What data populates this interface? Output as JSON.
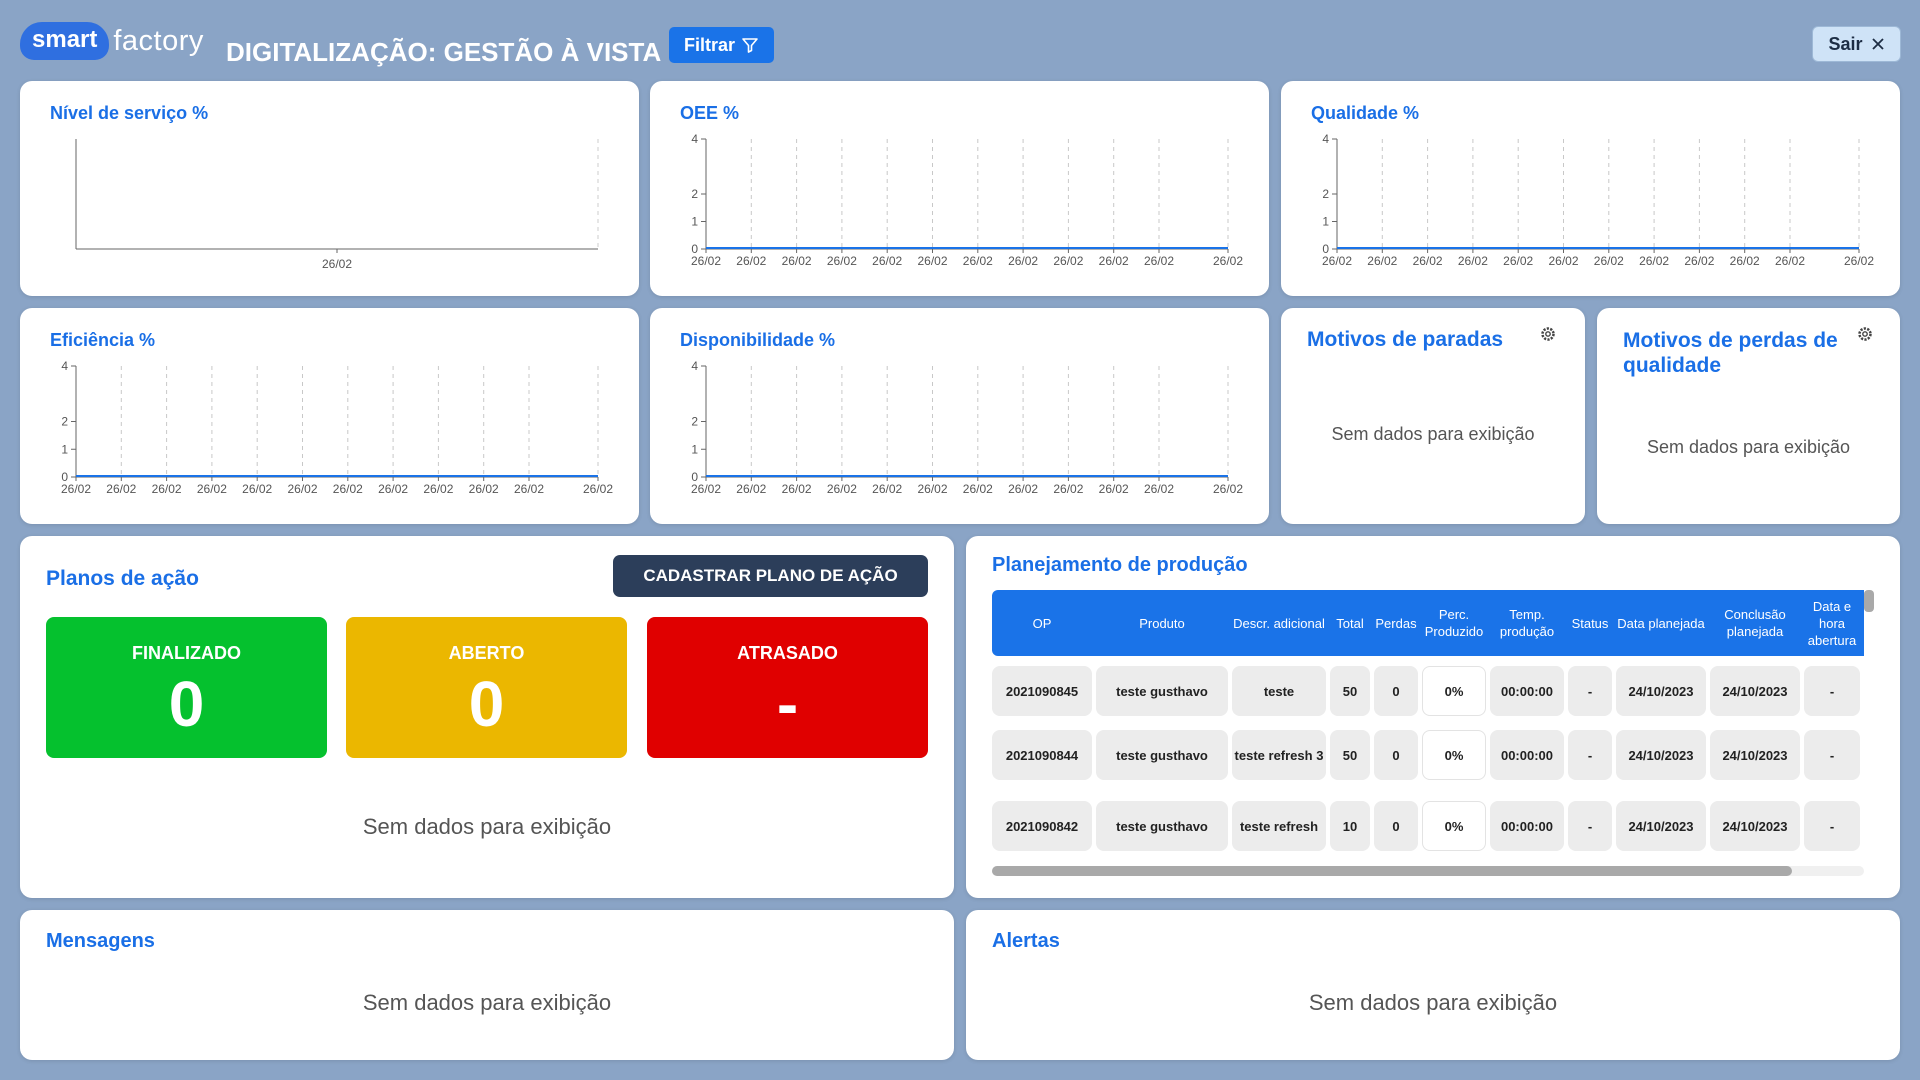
{
  "header": {
    "logo_word1": "smart",
    "logo_word2": "factory",
    "title": "DIGITALIZAÇÃO: GESTÃO À VISTA",
    "filter_label": "Filtrar",
    "exit_label": "Sair"
  },
  "charts": {
    "nivel_servico": {
      "title": "Nível de serviço %",
      "x_label": "26/02"
    },
    "oee": {
      "title": "OEE %",
      "y_ticks": [
        "4",
        "2",
        "1",
        "0"
      ],
      "x_labels": [
        "26/02",
        "26/02",
        "26/02",
        "26/02",
        "26/02",
        "26/02",
        "26/02",
        "26/02",
        "26/02",
        "26/02",
        "26/02",
        "26/02"
      ]
    },
    "qualidade": {
      "title": "Qualidade %",
      "y_ticks": [
        "4",
        "2",
        "1",
        "0"
      ],
      "x_labels": [
        "26/02",
        "26/02",
        "26/02",
        "26/02",
        "26/02",
        "26/02",
        "26/02",
        "26/02",
        "26/02",
        "26/02",
        "26/02",
        "26/02"
      ]
    },
    "eficiencia": {
      "title": "Eficiência %",
      "y_ticks": [
        "4",
        "2",
        "1",
        "0"
      ],
      "x_labels": [
        "26/02",
        "26/02",
        "26/02",
        "26/02",
        "26/02",
        "26/02",
        "26/02",
        "26/02",
        "26/02",
        "26/02",
        "26/02",
        "26/02"
      ]
    },
    "disponibilidade": {
      "title": "Disponibilidade %",
      "y_ticks": [
        "4",
        "2",
        "1",
        "0"
      ],
      "x_labels": [
        "26/02",
        "26/02",
        "26/02",
        "26/02",
        "26/02",
        "26/02",
        "26/02",
        "26/02",
        "26/02",
        "26/02",
        "26/02",
        "26/02"
      ]
    }
  },
  "motivos_paradas": {
    "title": "Motivos de paradas",
    "empty": "Sem dados para exibição",
    "icon": "gear-icon"
  },
  "motivos_perdas": {
    "title_line1": "Motivos de perdas de",
    "title_line2": "qualidade",
    "empty": "Sem dados para exibição",
    "icon": "gear-icon"
  },
  "planos": {
    "title": "Planos de ação",
    "button": "CADASTRAR PLANO DE AÇÃO",
    "statuses": [
      {
        "label": "FINALIZADO",
        "value": "0",
        "color": "#05c12e"
      },
      {
        "label": "ABERTO",
        "value": "0",
        "color": "#ebb700"
      },
      {
        "label": "ATRASADO",
        "value": "-",
        "color": "#e00000"
      }
    ],
    "empty": "Sem dados para exibição"
  },
  "planejamento": {
    "title": "Planejamento de produção",
    "headers": [
      "OP",
      "Produto",
      "Descr. adicional",
      "Total",
      "Perdas",
      "Perc. Produzido",
      "Temp. produção",
      "Status",
      "Data planejada",
      "Conclusão planejada",
      "Data e hora abertura"
    ],
    "rows": [
      [
        "2021090845",
        "teste gusthavo",
        "teste",
        "50",
        "0",
        "0%",
        "00:00:00",
        "-",
        "24/10/2023",
        "24/10/2023",
        "-"
      ],
      [
        "2021090844",
        "teste gusthavo",
        "teste refresh 3",
        "50",
        "0",
        "0%",
        "00:00:00",
        "-",
        "24/10/2023",
        "24/10/2023",
        "-"
      ],
      [
        "2021090842",
        "teste gusthavo",
        "teste refresh",
        "10",
        "0",
        "0%",
        "00:00:00",
        "-",
        "24/10/2023",
        "24/10/2023",
        "-"
      ]
    ]
  },
  "mensagens": {
    "title": "Mensagens",
    "empty": "Sem dados para exibição"
  },
  "alertas": {
    "title": "Alertas",
    "empty": "Sem dados para exibição"
  },
  "colors": {
    "accent": "#1a73e8",
    "title_blue": "#1a6fe6",
    "background": "#8aa4c6"
  }
}
